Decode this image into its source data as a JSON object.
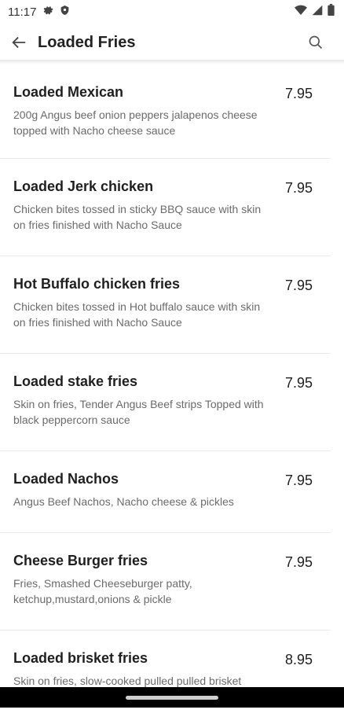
{
  "status": {
    "time": "11:17"
  },
  "appbar": {
    "title": "Loaded Fries"
  },
  "items": [
    {
      "name": "Loaded Mexican",
      "price": "7.95",
      "desc": "200g Angus beef onion peppers jalapenos cheese topped with Nacho cheese sauce"
    },
    {
      "name": "Loaded Jerk chicken",
      "price": "7.95",
      "desc": "Chicken bites tossed in sticky BBQ sauce with skin on fries finished with Nacho Sauce"
    },
    {
      "name": "Hot Buffalo chicken fries",
      "price": "7.95",
      "desc": "Chicken bites tossed in Hot buffalo sauce with skin on fries finished with Nacho Sauce"
    },
    {
      "name": "Loaded stake fries",
      "price": "7.95",
      "desc": "Skin on fries, Tender Angus Beef strips Topped with black peppercorn sauce"
    },
    {
      "name": "Loaded Nachos",
      "price": "7.95",
      "desc": "Angus Beef Nachos, Nacho cheese & pickles"
    },
    {
      "name": "Cheese Burger fries",
      "price": "7.95",
      "desc": "Fries, Smashed Cheeseburger patty, ketchup,mustard,onions & pickle"
    },
    {
      "name": "Loaded brisket fries",
      "price": "8.95",
      "desc": "Skin on fries, slow-cooked pulled pulled brisket"
    }
  ]
}
